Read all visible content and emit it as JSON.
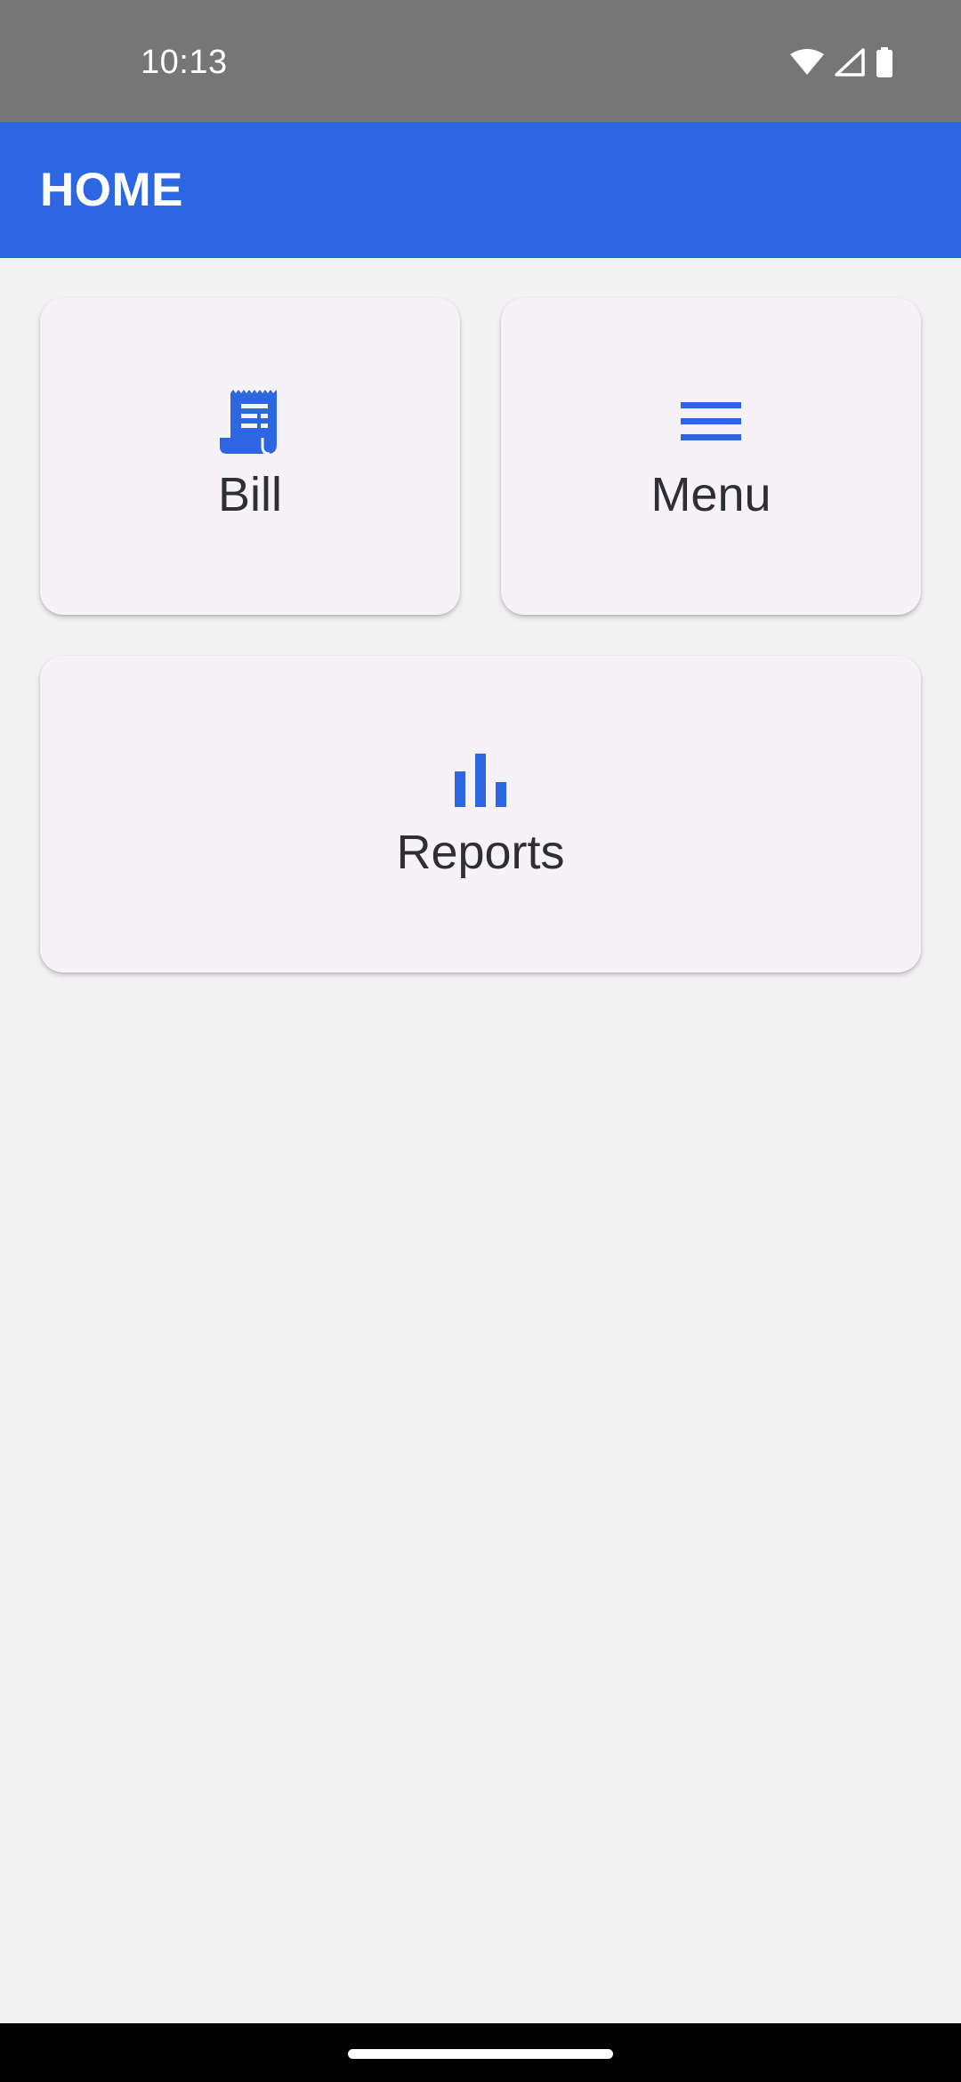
{
  "status_bar": {
    "time": "10:13",
    "icons": [
      "wifi-icon",
      "cellular-signal-icon",
      "battery-icon"
    ]
  },
  "app_bar": {
    "title": "HOME",
    "color": "#2d66e1"
  },
  "cards": [
    {
      "label": "Bill",
      "icon": "receipt-icon"
    },
    {
      "label": "Menu",
      "icon": "menu-lines-icon"
    },
    {
      "label": "Reports",
      "icon": "bar-chart-icon"
    }
  ],
  "colors": {
    "accent": "#2d66e1",
    "card_background": "#f6f2f8",
    "page_background": "#f2f2f2",
    "status_bar": "#767676"
  }
}
